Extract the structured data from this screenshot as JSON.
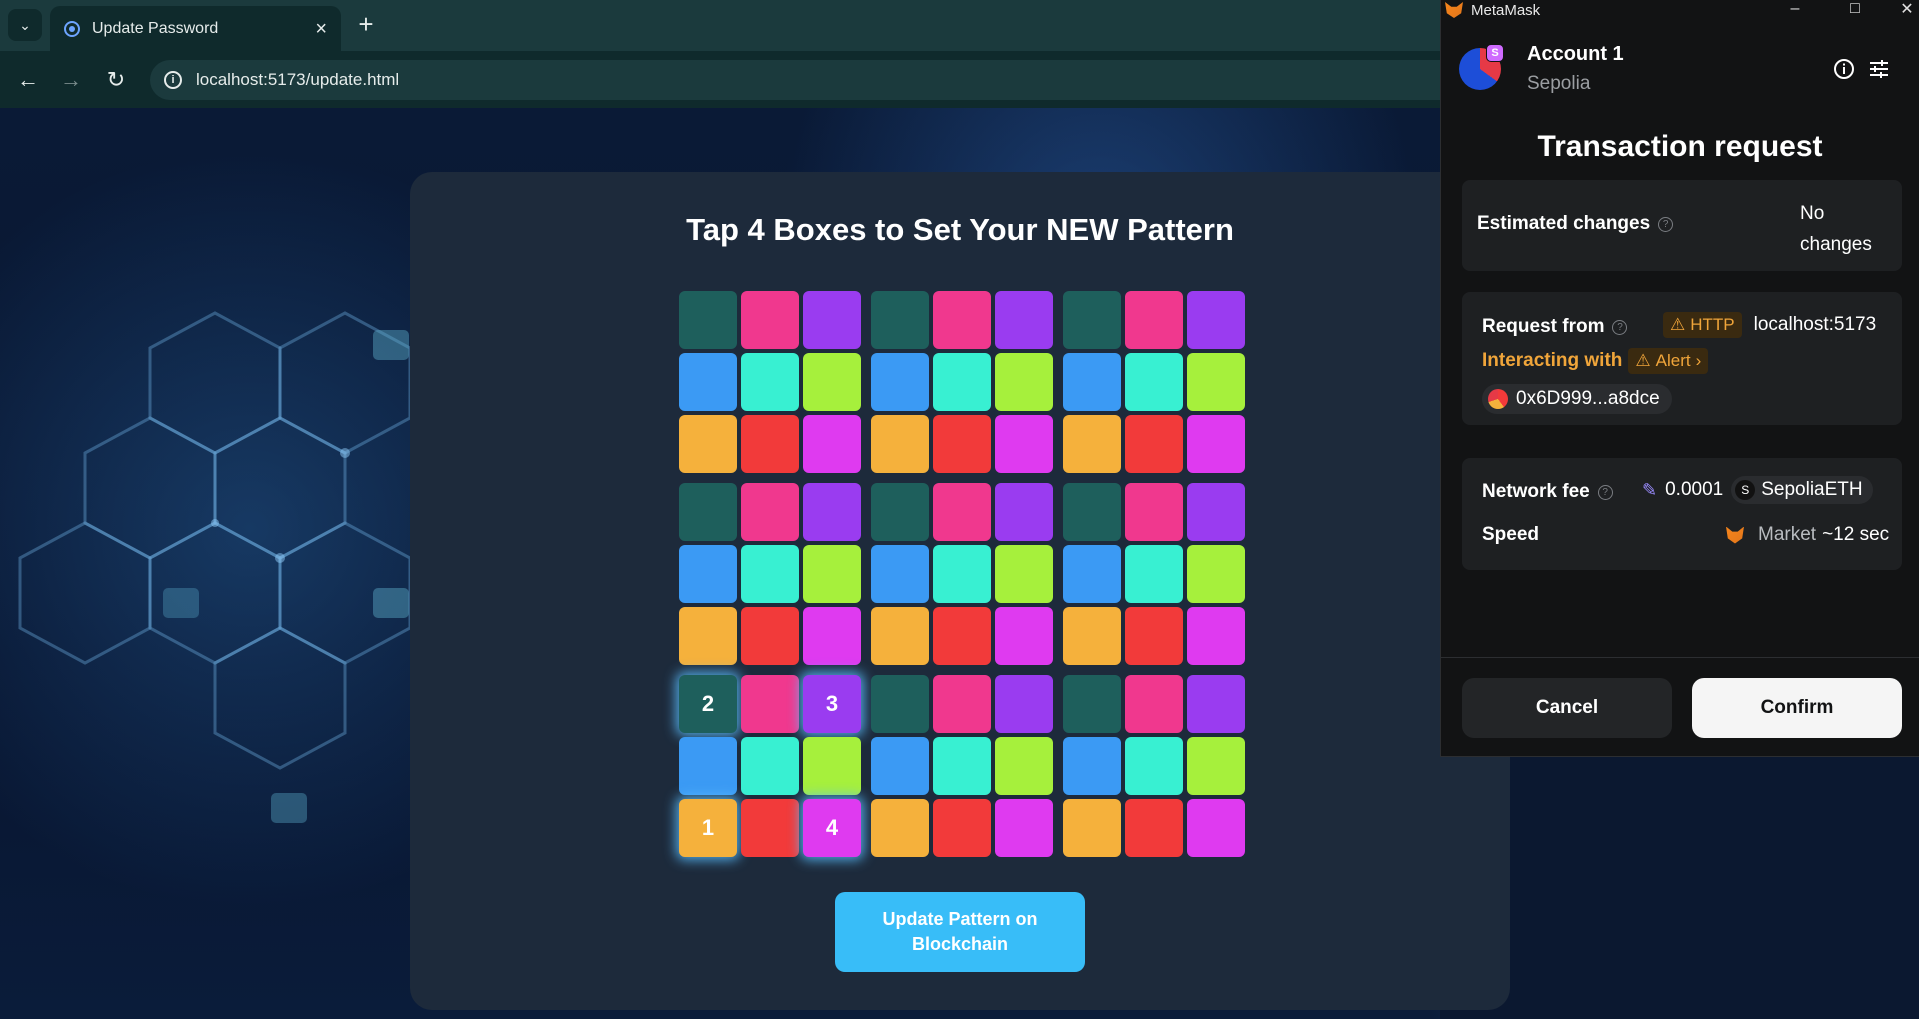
{
  "browser": {
    "tab_title": "Update Password",
    "new_tab_glyph": "+",
    "url": "localhost:5173/update.html"
  },
  "page": {
    "heading": "Tap 4 Boxes to Set Your NEW Pattern",
    "update_button": "Update Pattern on Blockchain",
    "palette": [
      "#1e5f5c",
      "#f0388e",
      "#9a3cf0",
      "#3b9af4",
      "#38f0d2",
      "#a6f03c",
      "#f5b13c",
      "#f23a3a",
      "#df3af0"
    ],
    "selections": [
      {
        "row": 8,
        "col": 0,
        "label": "1"
      },
      {
        "row": 6,
        "col": 0,
        "label": "2"
      },
      {
        "row": 6,
        "col": 2,
        "label": "3"
      },
      {
        "row": 8,
        "col": 2,
        "label": "4"
      }
    ]
  },
  "metamask": {
    "window_title": "MetaMask",
    "account_name": "Account 1",
    "network": "Sepolia",
    "network_badge": "S",
    "heading": "Transaction request",
    "estimated_changes_label": "Estimated changes",
    "estimated_changes_value": "No changes",
    "request_from_label": "Request from",
    "http_badge": "HTTP",
    "origin": "localhost:5173",
    "interacting_with_label": "Interacting with",
    "alert_badge": "Alert",
    "contract_address": "0x6D999...a8dce",
    "network_fee_label": "Network fee",
    "fee_amount": "0.0001",
    "fee_token_badge": "S",
    "fee_token": "SepoliaETH",
    "speed_label": "Speed",
    "speed_value": "Market",
    "speed_time": "~12 sec",
    "cancel_label": "Cancel",
    "confirm_label": "Confirm"
  }
}
